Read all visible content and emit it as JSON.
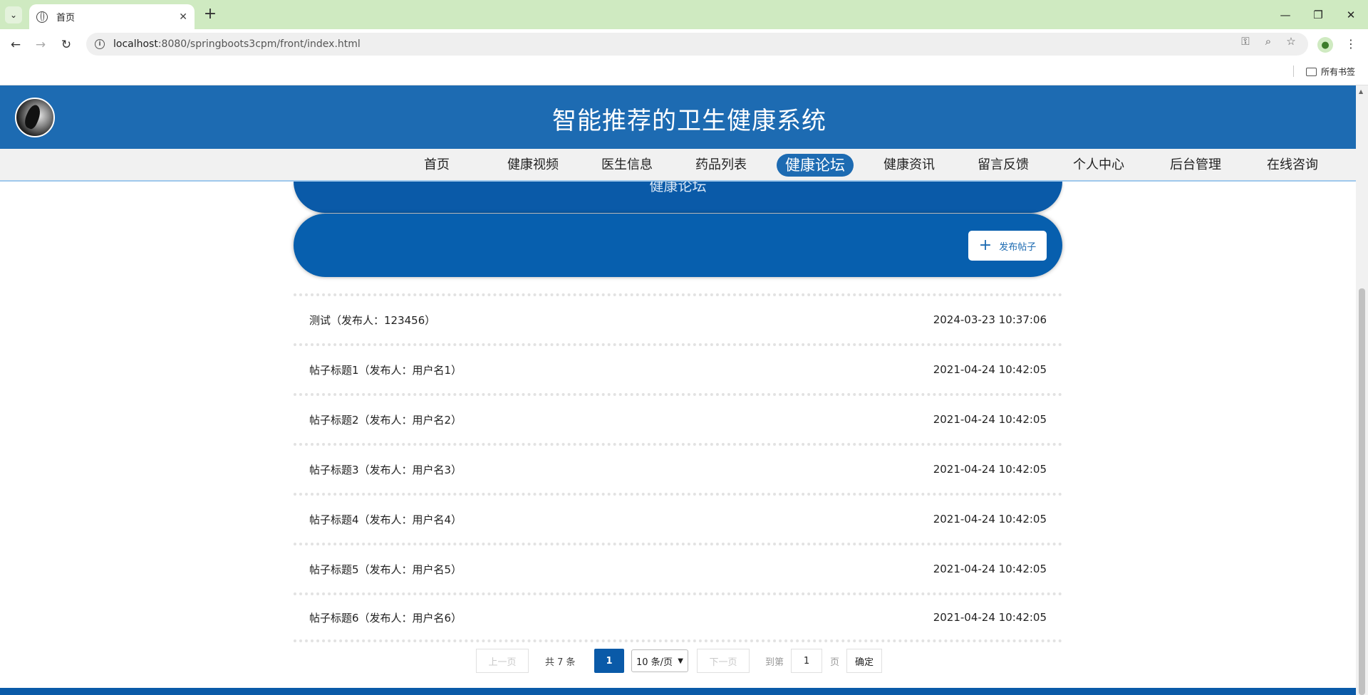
{
  "browser": {
    "tab_title": "首页",
    "url_host": "localhost",
    "url_rest": ":8080/springboots3cpm/front/index.html",
    "bookmarks_folder": "所有书签"
  },
  "site": {
    "title": "智能推荐的卫生健康系统"
  },
  "nav": {
    "items": [
      {
        "label": "首页"
      },
      {
        "label": "健康视频"
      },
      {
        "label": "医生信息"
      },
      {
        "label": "药品列表"
      },
      {
        "label": "健康论坛"
      },
      {
        "label": "健康资讯"
      },
      {
        "label": "留言反馈"
      },
      {
        "label": "个人中心"
      },
      {
        "label": "后台管理"
      },
      {
        "label": "在线咨询"
      }
    ],
    "active_index": 4
  },
  "section": {
    "heading": "健康论坛"
  },
  "actions": {
    "publish_label": "发布帖子"
  },
  "posts": [
    {
      "title": "测试（发布人：123456）",
      "time": "2024-03-23 10:37:06"
    },
    {
      "title": "帖子标题1（发布人：用户名1）",
      "time": "2021-04-24 10:42:05"
    },
    {
      "title": "帖子标题2（发布人：用户名2）",
      "time": "2021-04-24 10:42:05"
    },
    {
      "title": "帖子标题3（发布人：用户名3）",
      "time": "2021-04-24 10:42:05"
    },
    {
      "title": "帖子标题4（发布人：用户名4）",
      "time": "2021-04-24 10:42:05"
    },
    {
      "title": "帖子标题5（发布人：用户名5）",
      "time": "2021-04-24 10:42:05"
    },
    {
      "title": "帖子标题6（发布人：用户名6）",
      "time": "2021-04-24 10:42:05"
    }
  ],
  "pagination": {
    "prev_label": "上一页",
    "total_text": "共 7 条",
    "current_page": "1",
    "page_size": "10 条/页",
    "next_label": "下一页",
    "goto_prefix": "到第",
    "goto_value": "1",
    "goto_suffix": "页",
    "confirm_label": "确定"
  },
  "colors": {
    "brand_blue": "#1d6bb2",
    "banner_blue": "#075fae",
    "tab_strip": "#cfeac1"
  }
}
